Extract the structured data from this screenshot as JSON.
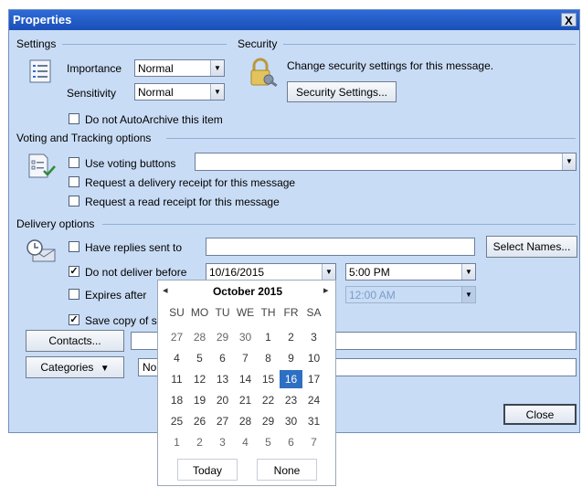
{
  "window": {
    "title": "Properties",
    "close_glyph": "X"
  },
  "settings": {
    "heading": "Settings",
    "importance_label": "Importance",
    "importance_value": "Normal",
    "sensitivity_label": "Sensitivity",
    "sensitivity_value": "Normal",
    "autoarchive_label": "Do not AutoArchive this item"
  },
  "security": {
    "heading": "Security",
    "description": "Change security settings for this message.",
    "button_label": "Security Settings..."
  },
  "voting": {
    "heading": "Voting and Tracking options",
    "use_voting_label": "Use voting buttons",
    "delivery_receipt_label": "Request a delivery receipt for this message",
    "read_receipt_label": "Request a read receipt for this message"
  },
  "delivery": {
    "heading": "Delivery options",
    "replies_label": "Have replies sent to",
    "select_names_label": "Select Names...",
    "deliver_before_label": "Do not deliver before",
    "deliver_date": "10/16/2015",
    "deliver_time": "5:00 PM",
    "expires_label": "Expires after",
    "expires_time": "12:00 AM",
    "save_copy_label": "Save copy of s"
  },
  "bottom": {
    "contacts_label": "Contacts...",
    "categories_label": "Categories",
    "categories_value": "No",
    "close_label": "Close"
  },
  "calendar": {
    "month_title": "October 2015",
    "prev_glyph": "◂",
    "next_glyph": "▸",
    "dow": [
      "SU",
      "MO",
      "TU",
      "WE",
      "TH",
      "FR",
      "SA"
    ],
    "weeks": [
      [
        "27",
        "28",
        "29",
        "30",
        "1",
        "2",
        "3"
      ],
      [
        "4",
        "5",
        "6",
        "7",
        "8",
        "9",
        "10"
      ],
      [
        "11",
        "12",
        "13",
        "14",
        "15",
        "16",
        "17"
      ],
      [
        "18",
        "19",
        "20",
        "21",
        "22",
        "23",
        "24"
      ],
      [
        "25",
        "26",
        "27",
        "28",
        "29",
        "30",
        "31"
      ],
      [
        "1",
        "2",
        "3",
        "4",
        "5",
        "6",
        "7"
      ]
    ],
    "selected_day": "16",
    "today_label": "Today",
    "none_label": "None"
  }
}
